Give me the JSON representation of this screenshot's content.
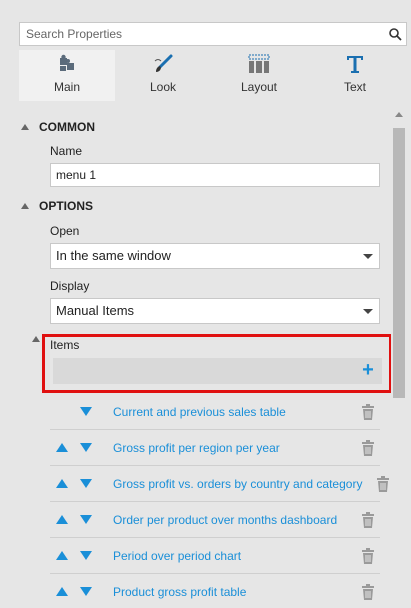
{
  "search": {
    "placeholder": "Search Properties"
  },
  "tabs": [
    {
      "label": "Main",
      "icon": "puzzle-icon",
      "active": true
    },
    {
      "label": "Look",
      "icon": "brush-icon",
      "active": false
    },
    {
      "label": "Layout",
      "icon": "layout-icon",
      "active": false
    },
    {
      "label": "Text",
      "icon": "text-icon",
      "active": false
    }
  ],
  "common": {
    "heading": "COMMON",
    "name_label": "Name",
    "name_value": "menu 1"
  },
  "options": {
    "heading": "OPTIONS",
    "open_label": "Open",
    "open_value": "In the same window",
    "display_label": "Display",
    "display_value": "Manual Items",
    "items_label": "Items"
  },
  "items": [
    {
      "label": "Current and previous sales table"
    },
    {
      "label": "Gross profit per region per year"
    },
    {
      "label": "Gross profit vs. orders by country and category"
    },
    {
      "label": "Order per product over months dashboard"
    },
    {
      "label": "Period over period chart"
    },
    {
      "label": "Product gross profit table"
    }
  ],
  "colors": {
    "accent": "#1a8fd8",
    "highlight": "#e01010",
    "background": "#e6e6e6"
  }
}
